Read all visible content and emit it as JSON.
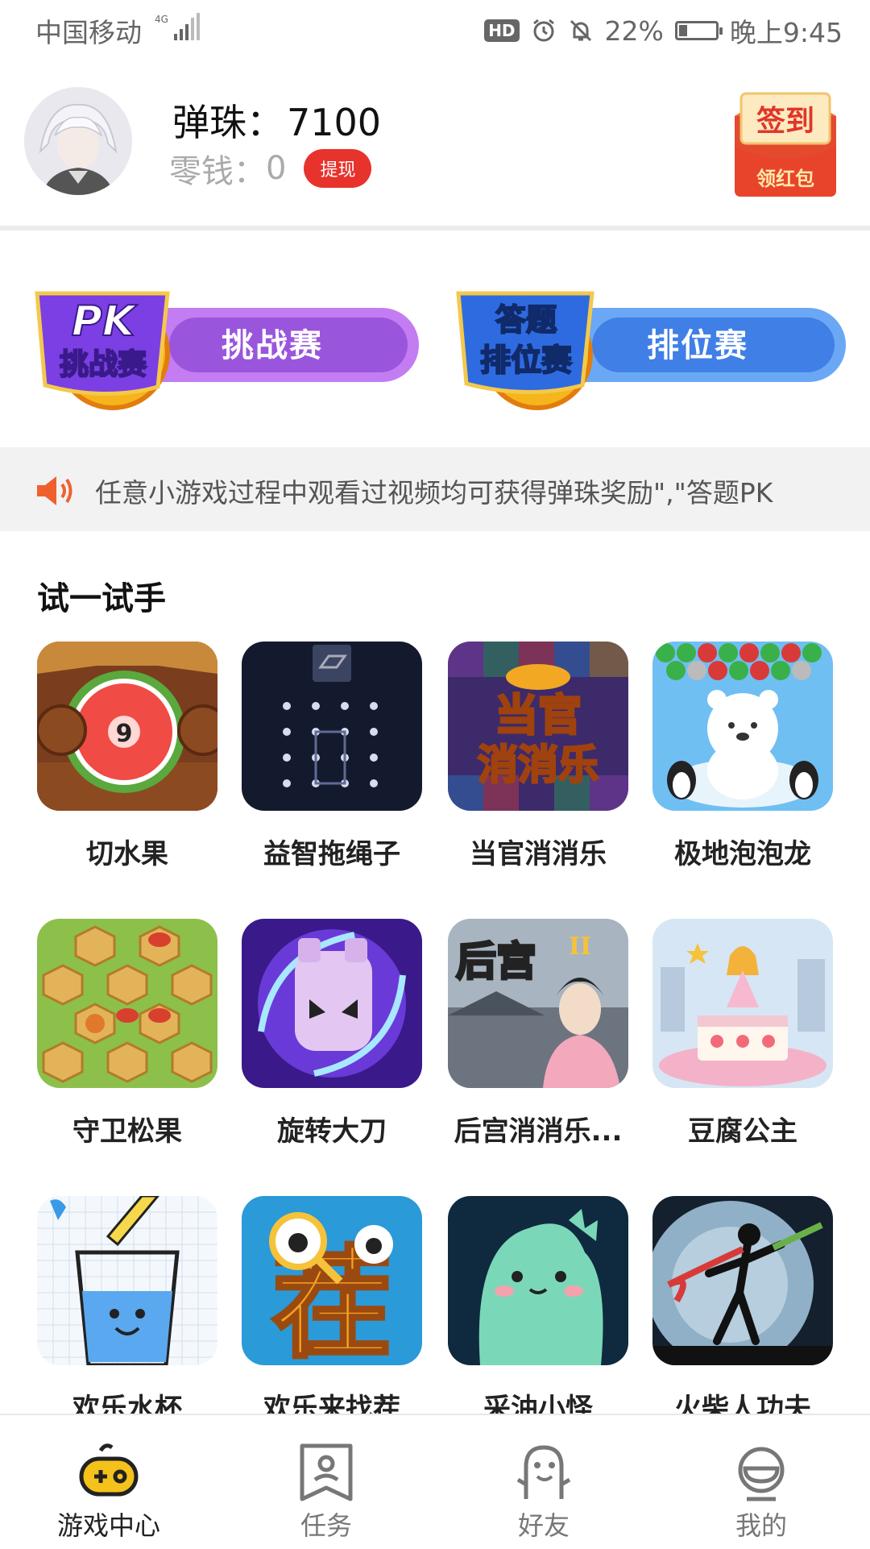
{
  "status_bar": {
    "carrier": "中国移动",
    "network": "4G",
    "hd": "HD",
    "battery": "22%",
    "time": "晚上9:45"
  },
  "header": {
    "marbles_label": "弹珠：",
    "marbles_value": "7100",
    "change_label": "零钱：",
    "change_value": "0",
    "withdraw_button": "提现",
    "checkin_top": "签到",
    "checkin_bottom": "领红包"
  },
  "modes": [
    {
      "badge_top": "PK",
      "badge_bottom": "挑战赛",
      "label": "挑战赛"
    },
    {
      "badge_top": "答题",
      "badge_bottom": "排位赛",
      "label": "排位赛"
    }
  ],
  "notice": {
    "icon": "speaker-icon",
    "text": "任意小游戏过程中观看过视频均可获得弹珠奖励\",\"答题PK"
  },
  "games_section": {
    "title": "试一试手",
    "games": [
      {
        "name": "切水果"
      },
      {
        "name": "益智拖绳子"
      },
      {
        "name": "当官消消乐"
      },
      {
        "name": "极地泡泡龙"
      },
      {
        "name": "守卫松果"
      },
      {
        "name": "旋转大刀"
      },
      {
        "name": "后宫消消乐..."
      },
      {
        "name": "豆腐公主"
      },
      {
        "name": "欢乐水杯"
      },
      {
        "name": "欢乐来找茬"
      },
      {
        "name": "采油小怪"
      },
      {
        "name": "火柴人功夫"
      }
    ],
    "icon_text": {
      "watermelon_number": "9",
      "official_title": "当官",
      "official_sub": "消消乐",
      "palace_title": "后宫",
      "palace_numeral": "II",
      "find_char": "茬"
    }
  },
  "bottom_nav": [
    {
      "label": "游戏中心",
      "icon": "gamepad-icon",
      "active": true
    },
    {
      "label": "任务",
      "icon": "task-icon",
      "active": false
    },
    {
      "label": "好友",
      "icon": "friends-icon",
      "active": false
    },
    {
      "label": "我的",
      "icon": "profile-icon",
      "active": false
    }
  ],
  "colors": {
    "accent_red": "#e8322c",
    "pk_purple": "#a25be0",
    "rank_blue": "#4f8ef0",
    "active_nav": "#f5c21b"
  }
}
